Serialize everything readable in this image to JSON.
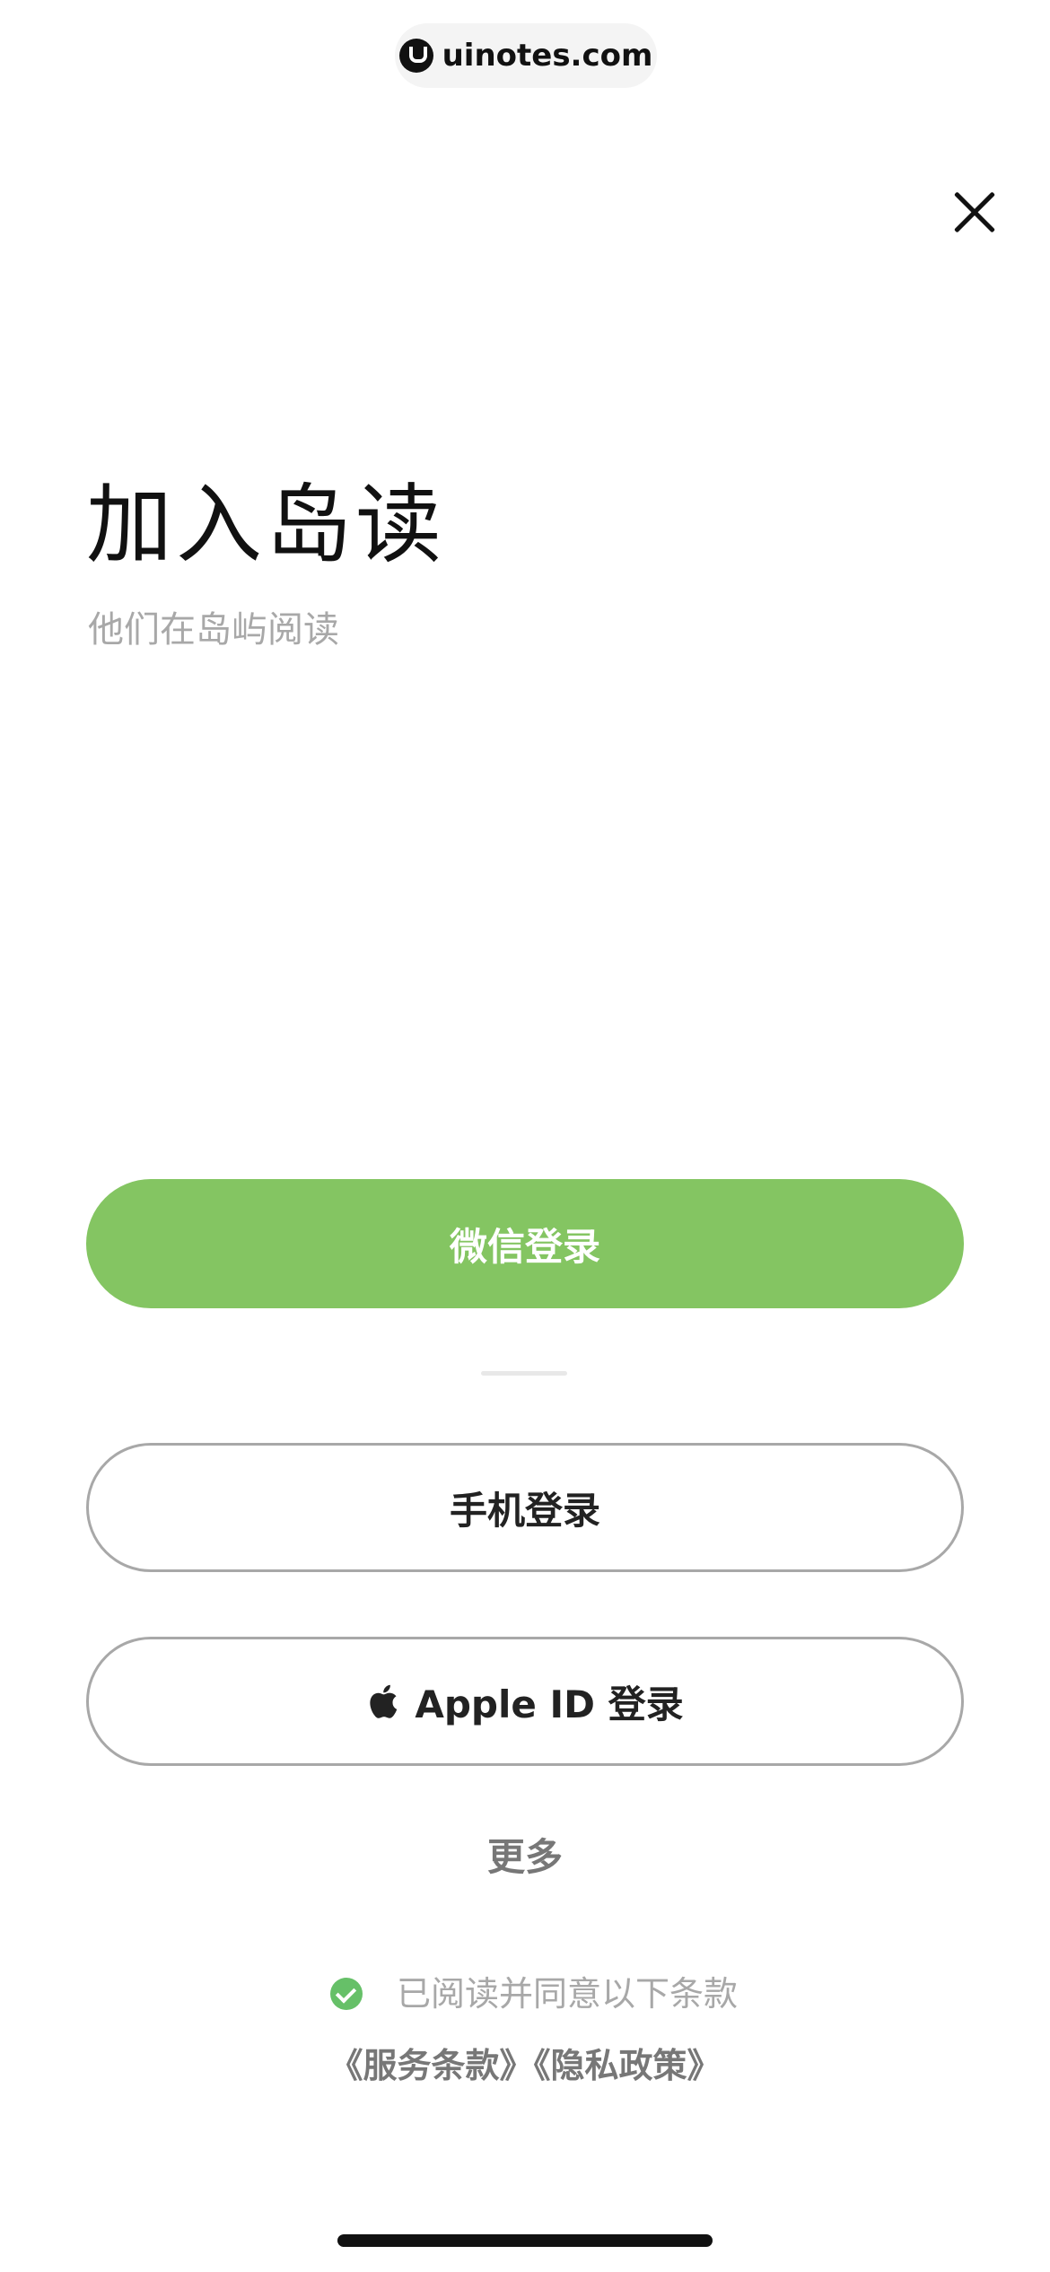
{
  "watermark": {
    "text": "uinotes.com"
  },
  "header": {
    "close_icon": "close-icon"
  },
  "hero": {
    "title": "加入岛读",
    "subtitle": "他们在岛屿阅读"
  },
  "login": {
    "wechat_label": "微信登录",
    "phone_label": "手机登录",
    "apple_label": "Apple ID 登录",
    "apple_icon": "apple-icon",
    "more_label": "更多"
  },
  "agreement": {
    "checked": true,
    "text": "已阅读并同意以下条款",
    "service_terms": "《服务条款》",
    "privacy_policy": "《隐私政策》"
  },
  "colors": {
    "wechat_green": "#84c562",
    "check_green": "#66c068",
    "subtitle_gray": "#a8a8a8",
    "border_gray": "#a8a8a8"
  }
}
